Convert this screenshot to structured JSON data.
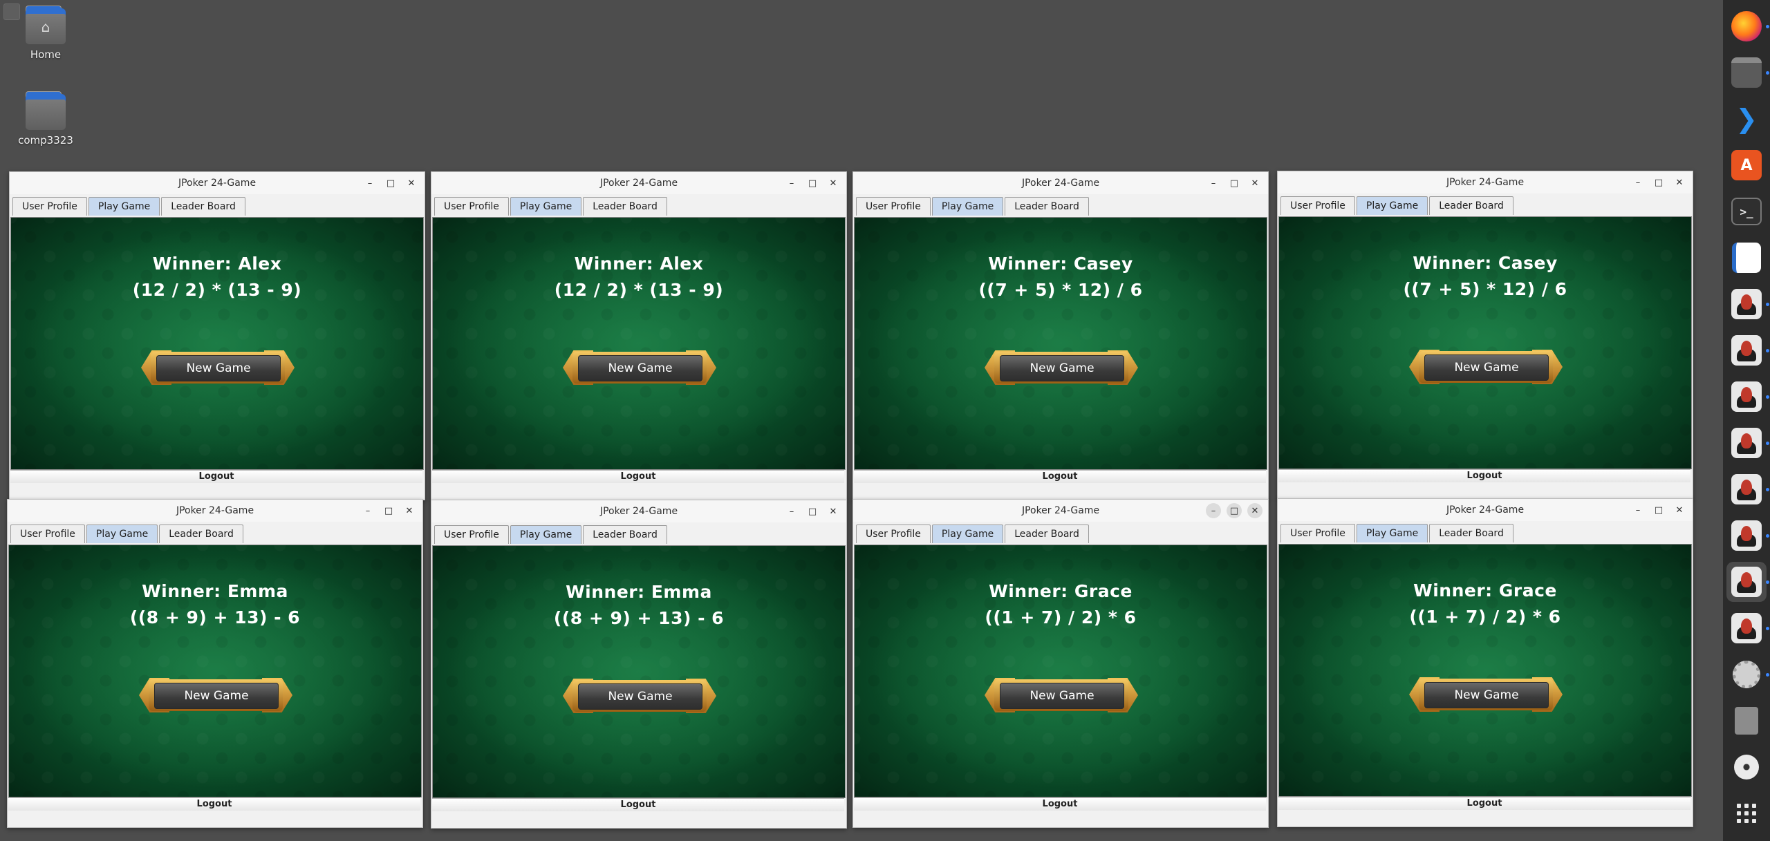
{
  "desktop": {
    "icons": [
      {
        "label": "Home"
      },
      {
        "label": "comp3323"
      }
    ]
  },
  "windows": [
    {
      "title": "JPoker 24-Game",
      "tabs": [
        "User Profile",
        "Play Game",
        "Leader Board"
      ],
      "selected_tab": "Play Game",
      "winner": "Winner: Alex",
      "expression": "(12 / 2) * (13 - 9)",
      "new_game": "New Game",
      "logout": "Logout"
    },
    {
      "title": "JPoker 24-Game",
      "tabs": [
        "User Profile",
        "Play Game",
        "Leader Board"
      ],
      "selected_tab": "Play Game",
      "winner": "Winner: Alex",
      "expression": "(12 / 2) * (13 - 9)",
      "new_game": "New Game",
      "logout": "Logout"
    },
    {
      "title": "JPoker 24-Game",
      "tabs": [
        "User Profile",
        "Play Game",
        "Leader Board"
      ],
      "selected_tab": "Play Game",
      "winner": "Winner: Casey",
      "expression": "((7 + 5) * 12) / 6",
      "new_game": "New Game",
      "logout": "Logout"
    },
    {
      "title": "JPoker 24-Game",
      "tabs": [
        "User Profile",
        "Play Game",
        "Leader Board"
      ],
      "selected_tab": "Play Game",
      "winner": "Winner: Casey",
      "expression": "((7 + 5) * 12) / 6",
      "new_game": "New Game",
      "logout": "Logout"
    },
    {
      "title": "JPoker 24-Game",
      "tabs": [
        "User Profile",
        "Play Game",
        "Leader Board"
      ],
      "selected_tab": "Play Game",
      "winner": "Winner: Emma",
      "expression": "((8 + 9) + 13) - 6",
      "new_game": "New Game",
      "logout": "Logout"
    },
    {
      "title": "JPoker 24-Game",
      "tabs": [
        "User Profile",
        "Play Game",
        "Leader Board"
      ],
      "selected_tab": "Play Game",
      "winner": "Winner: Emma",
      "expression": "((8 + 9) + 13) - 6",
      "new_game": "New Game",
      "logout": "Logout"
    },
    {
      "title": "JPoker 24-Game",
      "tabs": [
        "User Profile",
        "Play Game",
        "Leader Board"
      ],
      "selected_tab": "Play Game",
      "winner": "Winner: Grace",
      "expression": "((1 + 7) / 2) * 6",
      "new_game": "New Game",
      "logout": "Logout",
      "focused": true
    },
    {
      "title": "JPoker 24-Game",
      "tabs": [
        "User Profile",
        "Play Game",
        "Leader Board"
      ],
      "selected_tab": "Play Game",
      "winner": "Winner: Grace",
      "expression": "((1 + 7) / 2) * 6",
      "new_game": "New Game",
      "logout": "Logout"
    }
  ],
  "window_buttons": {
    "minimize": "–",
    "maximize": "□",
    "close": "✕"
  },
  "dock": {
    "items": [
      {
        "icon": "firefox-icon"
      },
      {
        "icon": "files-icon"
      },
      {
        "icon": "vscode-icon"
      },
      {
        "icon": "app-center-icon"
      },
      {
        "icon": "terminal-icon"
      },
      {
        "icon": "libreoffice-writer-icon"
      },
      {
        "icon": "java-app-icon"
      },
      {
        "icon": "java-app-icon"
      },
      {
        "icon": "java-app-icon"
      },
      {
        "icon": "java-app-icon"
      },
      {
        "icon": "java-app-icon"
      },
      {
        "icon": "java-app-icon"
      },
      {
        "icon": "java-app-icon"
      },
      {
        "icon": "java-app-icon",
        "active": true
      },
      {
        "icon": "java-app-icon"
      },
      {
        "icon": "settings-icon"
      },
      {
        "icon": "trash-icon"
      },
      {
        "icon": "disc-icon"
      },
      {
        "icon": "show-apps-icon"
      }
    ],
    "terminal_glyph": ">_",
    "vscode_glyph": "❯"
  }
}
